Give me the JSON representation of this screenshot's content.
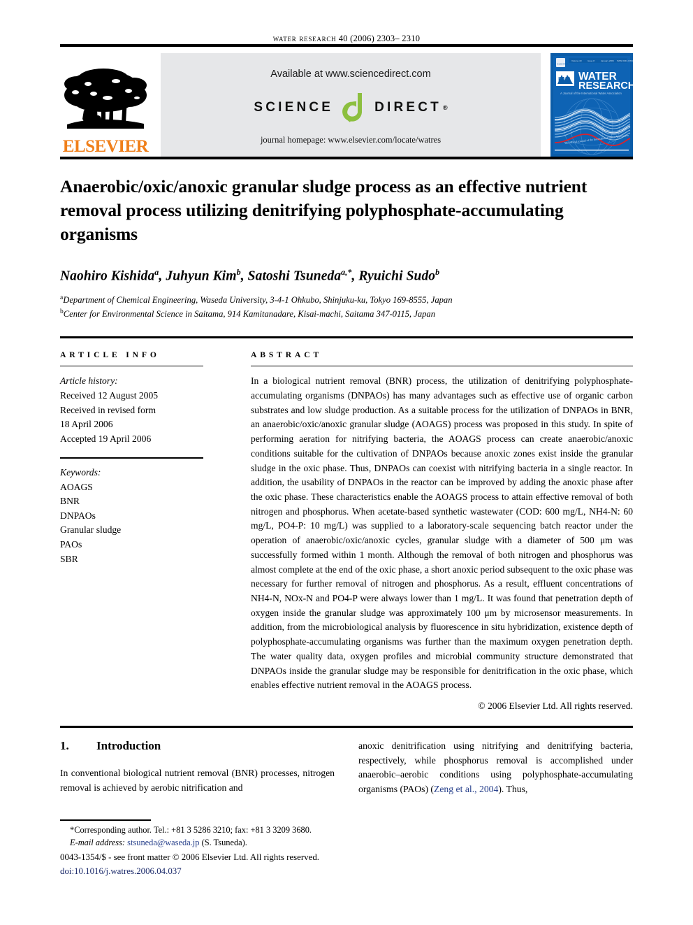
{
  "running_head": {
    "journal": "water research",
    "citation": "40 (2006) 2303– 2310"
  },
  "banner": {
    "elsevier_wordmark": "ELSEVIER",
    "available_at": "Available at www.sciencedirect.com",
    "sciencedirect_left": "SCIENCE",
    "sciencedirect_right": "DIRECT",
    "sciencedirect_reg": "®",
    "journal_homepage": "journal homepage: www.elsevier.com/locate/watres",
    "cover": {
      "publisher": "ELSEVIER",
      "society": "IWA",
      "title_line1": "WATER",
      "title_line2": "RESEARCH",
      "tagline": "A Journal of the International Water Association",
      "meta_volume": "Volume 40",
      "meta_issue": "Issue 8",
      "meta_date": "January 2006",
      "meta_issn": "ISSN 0043-1354"
    }
  },
  "article": {
    "title": "Anaerobic/oxic/anoxic granular sludge process as an effective nutrient removal process utilizing denitrifying polyphosphate-accumulating organisms",
    "authors": [
      {
        "name": "Naohiro Kishida",
        "sup": "a"
      },
      {
        "name": "Juhyun Kim",
        "sup": "b"
      },
      {
        "name": "Satoshi Tsuneda",
        "sup": "a,*"
      },
      {
        "name": "Ryuichi Sudo",
        "sup": "b"
      }
    ],
    "affiliations": [
      {
        "sup": "a",
        "text": "Department of Chemical Engineering, Waseda University, 3-4-1 Ohkubo, Shinjuku-ku, Tokyo 169-8555, Japan"
      },
      {
        "sup": "b",
        "text": "Center for Environmental Science in Saitama, 914 Kamitanadare, Kisai-machi, Saitama 347-0115, Japan"
      }
    ]
  },
  "article_info": {
    "heading": "ARTICLE INFO",
    "history_label": "Article history:",
    "history": [
      "Received 12 August 2005",
      "Received in revised form",
      "18 April 2006",
      "Accepted 19 April 2006"
    ],
    "keywords_label": "Keywords:",
    "keywords": [
      "AOAGS",
      "BNR",
      "DNPAOs",
      "Granular sludge",
      "PAOs",
      "SBR"
    ]
  },
  "abstract": {
    "heading": "ABSTRACT",
    "text": "In a biological nutrient removal (BNR) process, the utilization of denitrifying polyphosphate-accumulating organisms (DNPAOs) has many advantages such as effective use of organic carbon substrates and low sludge production. As a suitable process for the utilization of DNPAOs in BNR, an anaerobic/oxic/anoxic granular sludge (AOAGS) process was proposed in this study. In spite of performing aeration for nitrifying bacteria, the AOAGS process can create anaerobic/anoxic conditions suitable for the cultivation of DNPAOs because anoxic zones exist inside the granular sludge in the oxic phase. Thus, DNPAOs can coexist with nitrifying bacteria in a single reactor. In addition, the usability of DNPAOs in the reactor can be improved by adding the anoxic phase after the oxic phase. These characteristics enable the AOAGS process to attain effective removal of both nitrogen and phosphorus. When acetate-based synthetic wastewater (COD: 600 mg/L, NH4-N: 60 mg/L, PO4-P: 10 mg/L) was supplied to a laboratory-scale sequencing batch reactor under the operation of anaerobic/oxic/anoxic cycles, granular sludge with a diameter of 500 μm was successfully formed within 1 month. Although the removal of both nitrogen and phosphorus was almost complete at the end of the oxic phase, a short anoxic period subsequent to the oxic phase was necessary for further removal of nitrogen and phosphorus. As a result, effluent concentrations of NH4-N, NOx-N and PO4-P were always lower than 1 mg/L. It was found that penetration depth of oxygen inside the granular sludge was approximately 100 μm by microsensor measurements. In addition, from the microbiological analysis by fluorescence in situ hybridization, existence depth of polyphosphate-accumulating organisms was further than the maximum oxygen penetration depth. The water quality data, oxygen profiles and microbial community structure demonstrated that DNPAOs inside the granular sludge may be responsible for denitrification in the oxic phase, which enables effective nutrient removal in the AOAGS process.",
    "copyright": "© 2006 Elsevier Ltd. All rights reserved."
  },
  "introduction": {
    "number": "1.",
    "heading": "Introduction",
    "col1": "In conventional biological nutrient removal (BNR) processes, nitrogen removal is achieved by aerobic nitrification and",
    "col2_pre": "anoxic denitrification using nitrifying and denitrifying bacteria, respectively, while phosphorus removal is accomplished under anaerobic–aerobic conditions using polyphosphate-accumulating organisms (PAOs) (",
    "col2_cite": "Zeng et al., 2004",
    "col2_post": "). Thus,"
  },
  "footer": {
    "corresponding": "*Corresponding author. Tel.: +81 3 5286 3210; fax: +81 3 3209 3680.",
    "email_label": "E-mail address:",
    "email": "stsuneda@waseda.jp",
    "email_owner": "(S. Tsuneda).",
    "issn_line": "0043-1354/$ - see front matter © 2006 Elsevier Ltd. All rights reserved.",
    "doi": "doi:10.1016/j.watres.2006.04.037"
  },
  "colors": {
    "elsevier_orange": "#F07F1A",
    "sciencedirect_green": "#8CBF3F",
    "banner_gray": "#e6e7e9",
    "cover_blue": "#0b5ca8",
    "link_blue": "#27408B"
  }
}
